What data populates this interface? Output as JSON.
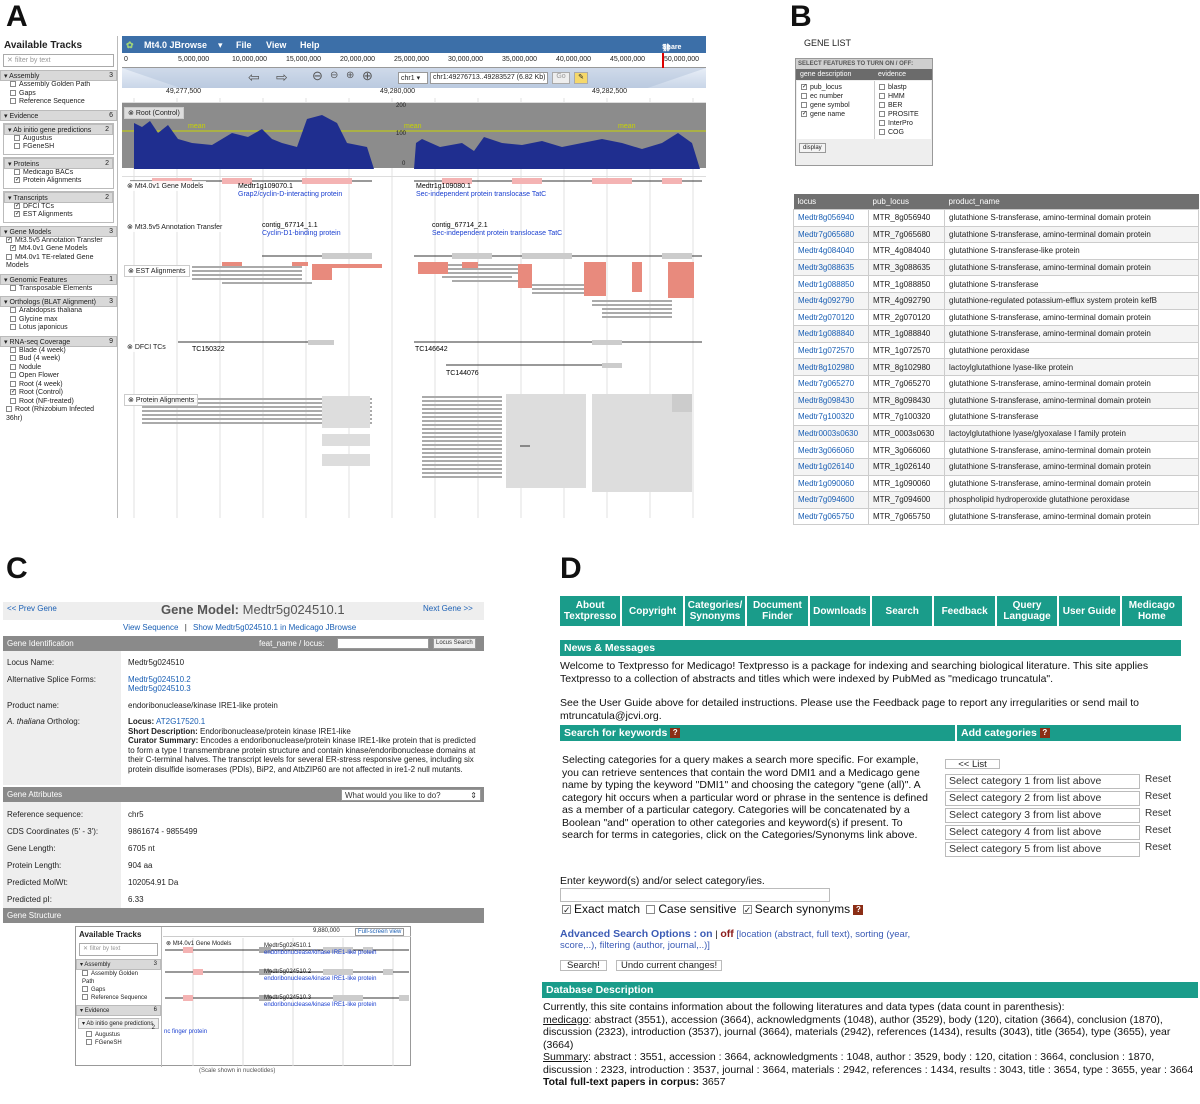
{
  "labels": {
    "a": "A",
    "b": "B",
    "c": "C",
    "d": "D"
  },
  "jbrowse": {
    "sidebar_title": "Available Tracks",
    "filter_placeholder": "filter by text",
    "categories": [
      {
        "name": "Assembly",
        "count": "3",
        "items": [
          {
            "label": "Assembly Golden Path",
            "on": false
          },
          {
            "label": "Gaps",
            "on": false
          },
          {
            "label": "Reference Sequence",
            "on": false
          }
        ]
      },
      {
        "name": "Evidence",
        "count": "6",
        "items": []
      },
      {
        "name": "Gene Models",
        "count": "3",
        "items": [
          {
            "label": "Mt3.5v5 Annotation Transfer",
            "on": true
          },
          {
            "label": "Mt4.0v1 Gene Models",
            "on": true
          },
          {
            "label": "Mt4.0v1 TE-related Gene Models",
            "on": false
          }
        ]
      },
      {
        "name": "Genomic Features",
        "count": "1",
        "items": [
          {
            "label": "Transposable Elements",
            "on": false
          }
        ]
      },
      {
        "name": "Orthologs (BLAT Alignment)",
        "count": "3",
        "items": [
          {
            "label": "Arabidopsis thaliana",
            "on": false
          },
          {
            "label": "Glycine max",
            "on": false
          },
          {
            "label": "Lotus japonicus",
            "on": false
          }
        ]
      },
      {
        "name": "RNA-seq Coverage",
        "count": "9",
        "items": [
          {
            "label": "Blade (4 week)",
            "on": false
          },
          {
            "label": "Bud (4 week)",
            "on": false
          },
          {
            "label": "Nodule",
            "on": false
          },
          {
            "label": "Open Flower",
            "on": false
          },
          {
            "label": "Root (4 week)",
            "on": false
          },
          {
            "label": "Root (Control)",
            "on": true
          },
          {
            "label": "Root (NF-treated)",
            "on": false
          },
          {
            "label": "Root (Rhizobium Infected 36hr)",
            "on": false
          }
        ]
      }
    ],
    "evidence_subs": [
      {
        "name": "Ab initio gene predictions",
        "count": "2",
        "items": [
          {
            "label": "Augustus",
            "on": false
          },
          {
            "label": "FGeneSH",
            "on": false
          }
        ]
      },
      {
        "name": "Proteins",
        "count": "2",
        "items": [
          {
            "label": "Medicago BACs",
            "on": false
          },
          {
            "label": "Protein Alignments",
            "on": true
          }
        ]
      },
      {
        "name": "Transcripts",
        "count": "2",
        "items": [
          {
            "label": "DFCI TCs",
            "on": true
          },
          {
            "label": "EST Alignments",
            "on": true
          }
        ]
      }
    ],
    "menu": {
      "logo": "Mt4.0 JBrowse",
      "file": "File",
      "view": "View",
      "help": "Help",
      "share": "Share"
    },
    "ruler": [
      "0",
      "5,000,000",
      "10,000,000",
      "15,000,000",
      "20,000,000",
      "25,000,000",
      "30,000,000",
      "35,000,000",
      "40,000,000",
      "45,000,000",
      "50,000,000"
    ],
    "nav": {
      "chrom": "chr1",
      "location": "chr1:49276713..49283527 (6.82 Kb)",
      "go": "Go"
    },
    "coords": [
      "49,277,500",
      "49,280,000",
      "49,282,500"
    ],
    "tracks": {
      "root": "Root (Control)",
      "mean": "mean",
      "yticks": [
        "200",
        "100",
        "0"
      ],
      "gene_models": "Mt4.0v1 Gene Models",
      "annot_transfer": "Mt3.5v5 Annotation Transfer",
      "est": "EST Alignments",
      "dfci": "DFCI TCs",
      "protein": "Protein Alignments"
    },
    "features": {
      "g1_name": "Medtr1g109070.1",
      "g1_desc": "Grap2/cyclin-D-interacting protein",
      "g2_name": "Medtr1g109080.1",
      "g2_desc": "Sec-independent protein translocase TatC",
      "c1_name": "contig_67714_1.1",
      "c1_desc": "Cyclin-D1-binding protein",
      "c2_name": "contig_67714_2.1",
      "c2_desc": "Sec-independent protein translocase TatC",
      "tc1": "TC150322",
      "tc2": "TC146642",
      "tc3": "TC144076"
    }
  },
  "genelist": {
    "title": "GENE LIST",
    "select_header": "SELECT FEATURES TO TURN ON / OFF:",
    "col1_header": "gene description",
    "col2_header": "evidence",
    "col1": [
      {
        "label": "pub_locus",
        "on": true
      },
      {
        "label": "ec number",
        "on": false
      },
      {
        "label": "gene symbol",
        "on": false
      },
      {
        "label": "gene name",
        "on": true
      }
    ],
    "col2": [
      {
        "label": "blastp",
        "on": false
      },
      {
        "label": "HMM",
        "on": false
      },
      {
        "label": "BER",
        "on": false
      },
      {
        "label": "PROSITE",
        "on": false
      },
      {
        "label": "InterPro",
        "on": false
      },
      {
        "label": "COG",
        "on": false
      }
    ],
    "display_btn": "display",
    "headers": [
      "locus",
      "pub_locus",
      "product_name"
    ],
    "rows": [
      [
        "Medtr8g056940",
        "MTR_8g056940",
        "glutathione S-transferase, amino-terminal domain protein"
      ],
      [
        "Medtr7g065680",
        "MTR_7g065680",
        "glutathione S-transferase, amino-terminal domain protein"
      ],
      [
        "Medtr4g084040",
        "MTR_4g084040",
        "glutathione S-transferase-like protein"
      ],
      [
        "Medtr3g088635",
        "MTR_3g088635",
        "glutathione S-transferase, amino-terminal domain protein"
      ],
      [
        "Medtr1g088850",
        "MTR_1g088850",
        "glutathione S-transferase"
      ],
      [
        "Medtr4g092790",
        "MTR_4g092790",
        "glutathione-regulated potassium-efflux system protein kefB"
      ],
      [
        "Medtr2g070120",
        "MTR_2g070120",
        "glutathione S-transferase, amino-terminal domain protein"
      ],
      [
        "Medtr1g088840",
        "MTR_1g088840",
        "glutathione S-transferase, amino-terminal domain protein"
      ],
      [
        "Medtr1g072570",
        "MTR_1g072570",
        "glutathione peroxidase"
      ],
      [
        "Medtr8g102980",
        "MTR_8g102980",
        "lactoylglutathione lyase-like protein"
      ],
      [
        "Medtr7g065270",
        "MTR_7g065270",
        "glutathione S-transferase, amino-terminal domain protein"
      ],
      [
        "Medtr8g098430",
        "MTR_8g098430",
        "glutathione S-transferase, amino-terminal domain protein"
      ],
      [
        "Medtr7g100320",
        "MTR_7g100320",
        "glutathione S-transferase"
      ],
      [
        "Medtr0003s0630",
        "MTR_0003s0630",
        "lactoylglutathione lyase/glyoxalase I family protein"
      ],
      [
        "Medtr3g066060",
        "MTR_3g066060",
        "glutathione S-transferase, amino-terminal domain protein"
      ],
      [
        "Medtr1g026140",
        "MTR_1g026140",
        "glutathione S-transferase, amino-terminal domain protein"
      ],
      [
        "Medtr1g090060",
        "MTR_1g090060",
        "glutathione S-transferase, amino-terminal domain protein"
      ],
      [
        "Medtr7g094600",
        "MTR_7g094600",
        "phospholipid hydroperoxide glutathione peroxidase"
      ],
      [
        "Medtr7g065750",
        "MTR_7g065750",
        "glutathione S-transferase, amino-terminal domain protein"
      ]
    ]
  },
  "genemodel": {
    "prev": "<< Prev Gene",
    "title_prefix": "Gene Model:",
    "title_id": "Medtr5g024510.1",
    "next": "Next Gene >>",
    "view_seq": "View Sequence",
    "sep": "|",
    "show_link": "Show Medtr5g024510.1 in Medicago JBrowse",
    "gene_id_bar": "Gene Identification",
    "feat_label": "feat_name / locus:",
    "locus_search": "Locus Search",
    "locus_name_k": "Locus Name:",
    "locus_name_v": "Medtr5g024510",
    "alt_k": "Alternative Splice Forms:",
    "alt_v1": "Medtr5g024510.2",
    "alt_v2": "Medtr5g024510.3",
    "product_k": "Product name:",
    "product_v": "endoribonuclease/kinase IRE1-like protein",
    "ortho_k_italic": "A. thaliana",
    "ortho_k_rest": " Ortholog:",
    "ortho_locus_label": "Locus:",
    "ortho_locus": "AT2G17520.1",
    "short_desc_label": "Short Description:",
    "short_desc": "Endoribonuclease/protein kinase IRE1-like",
    "curator_label": "Curator Summary:",
    "curator": "Encodes a endoribonuclease/protein kinase IRE1-like protein that is predicted to form a type I transmembrane protein structure and contain kinase/endoribonuclease domains at their C-terminal halves. The transcript levels for several ER-stress responsive genes, including six protein disulfide isomerases (PDIs), BiP2, and AtbZIP60 are not affected in ire1-2 null mutants.",
    "attr_bar": "Gene Attributes",
    "attr_select": "What would you like to do?",
    "attrs": [
      [
        "Reference sequence:",
        "chr5"
      ],
      [
        "CDS Coordinates (5' - 3'):",
        "9861674 - 9855499"
      ],
      [
        "Gene Length:",
        "6705 nt"
      ],
      [
        "Protein Length:",
        "904 aa"
      ],
      [
        "Predicted MolWt:",
        "102054.91 Da"
      ],
      [
        "Predicted pI:",
        "6.33"
      ]
    ],
    "struct_bar": "Gene Structure",
    "mini": {
      "title": "Available Tracks",
      "filter": "filter by text",
      "assembly": "Assembly",
      "assembly_n": "3",
      "items": [
        "Assembly Golden Path",
        "Gaps",
        "Reference Sequence"
      ],
      "evidence": "Evidence",
      "evidence_n": "6",
      "abinitio": "Ab initio gene predictions",
      "abinitio_n": "2",
      "ab_items": [
        "Augustus",
        "FGeneSH"
      ],
      "coord": "9,880,000",
      "fullscreen": "Full-screen view",
      "track": "Mt4.0v1 Gene Models",
      "g1": "Medtr5g024510.1",
      "g2": "Medtr5g024510.2",
      "g3": "Medtr5g024510.3",
      "desc": "endoribonuclease/kinase IRE1-like protein",
      "zinc": "nc finger protein",
      "scale": "(Scale shown in nucleotides)"
    }
  },
  "textpresso": {
    "nav": [
      "About Textpresso",
      "Copyright",
      "Categories/ Synonyms",
      "Document Finder",
      "Downloads",
      "Search",
      "Feedback",
      "Query Language",
      "User Guide",
      "Medicago Home"
    ],
    "news_bar": "News & Messages",
    "welcome": "Welcome to Textpresso for Medicago! Textpresso is a package for indexing and searching biological literature. This site applies Textpresso to a collection of abstracts and titles which were indexed by PubMed as \"medicago truncatula\".",
    "guide": "See the User Guide above for detailed instructions. Please use the Feedback page to report any irregularities or send mail to mtruncatula@jcvi.org.",
    "search_kw_bar": "Search for keywords",
    "add_cat_bar": "Add categories",
    "search_help": "Selecting categories for a query makes a search more specific. For example, you can retrieve sentences that contain the word DMI1 and a Medicago gene name by typing the keyword \"DMI1\" and choosing the category \"gene (all)\". A category hit occurs when a particular word or phrase in the sentence is defined as a member of a particular category. Categories will be concatenated by a Boolean \"and\" operation to other categories and keyword(s) if present. To search for terms in categories, click on the Categories/Synonyms link above.",
    "list_btn": "<< List",
    "cats": [
      "Select category 1 from list above",
      "Select category 2 from list above",
      "Select category 3 from list above",
      "Select category 4 from list above",
      "Select category 5 from list above"
    ],
    "reset": "Reset",
    "enter_kw": "Enter keyword(s) and/or select category/ies.",
    "exact": "Exact match",
    "case": "Case sensitive",
    "syn": "Search synonyms",
    "adv_label": "Advanced Search Options :",
    "adv_on": "on",
    "adv_sep": "|",
    "adv_off": "off",
    "adv_desc": "[location (abstract, full text), sorting (year, score,..), filtering (author, journal,..)]",
    "search_btn": "Search!",
    "undo_btn": "Undo current changes!",
    "db_bar": "Database Description",
    "db_intro": "Currently, this site contains information about the following literatures and data types (data count in parenthesis):",
    "med_label": "medicago",
    "med_text": ": abstract (3551), accession (3664), acknowledgments (1048), author (3529), body (120), citation (3664), conclusion (1870), discussion (2323), introduction (3537), journal (3664), materials (2942), references (1434), results (3043), title (3654), type (3655), year (3664)",
    "sum_label": "Summary",
    "sum_text": ": abstract : 3551, accession : 3664, acknowledgments : 1048, author : 3529, body : 120, citation : 3664, conclusion : 1870, discussion : 2323, introduction : 3537, journal : 3664, materials : 2942, references : 1434, results : 3043, title : 3654, type : 3655, year : 3664",
    "total_label": "Total full-text papers in corpus:",
    "total_val": "3657"
  },
  "colors": {
    "teal": "#1a9c8a",
    "jbrowse_blue": "#3c6fa8",
    "coverage": "#1f2e8f",
    "est_red": "#e88a7d",
    "link": "#1a5fb4"
  }
}
